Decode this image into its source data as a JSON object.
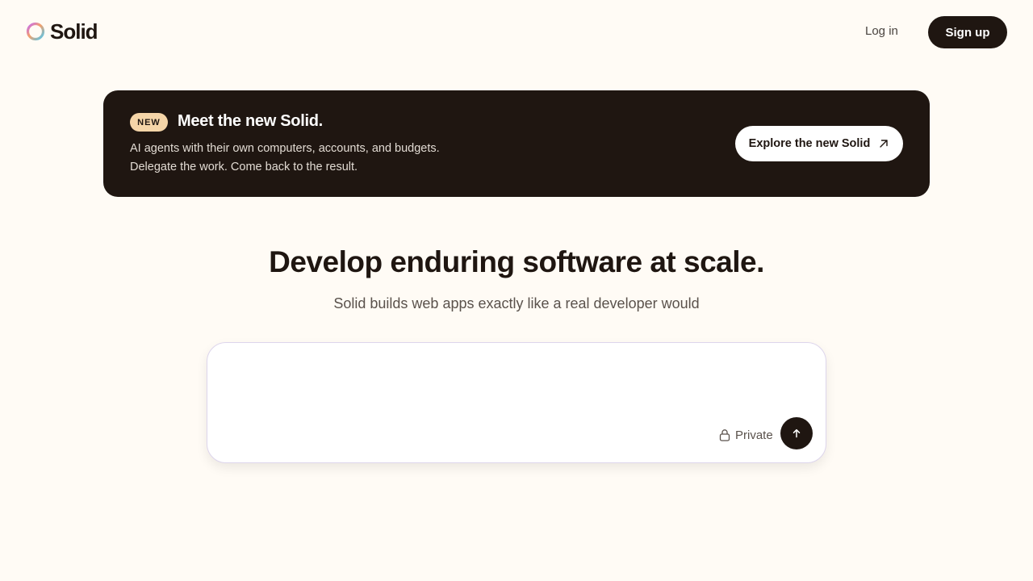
{
  "brand": {
    "name": "Solid",
    "logo_icon": "ring-gradient-icon"
  },
  "nav": {
    "login_label": "Log in",
    "signup_label": "Sign up"
  },
  "banner": {
    "badge": "NEW",
    "title": "Meet the new Solid.",
    "line1": "AI agents with their own computers, accounts, and budgets.",
    "line2": "Delegate the work. Come back to the result.",
    "cta_label": "Explore the new Solid",
    "cta_icon": "arrow-up-right-icon"
  },
  "hero": {
    "title": "Develop enduring software at scale.",
    "subtitle": "Solid builds web apps exactly like a real developer would"
  },
  "prompt": {
    "value": "",
    "placeholder": "",
    "privacy_label": "Private",
    "privacy_icon": "lock-icon",
    "send_icon": "arrow-up-icon"
  },
  "colors": {
    "background": "#fffbf5",
    "dark": "#1f1611",
    "badge": "#f5d5a8"
  }
}
